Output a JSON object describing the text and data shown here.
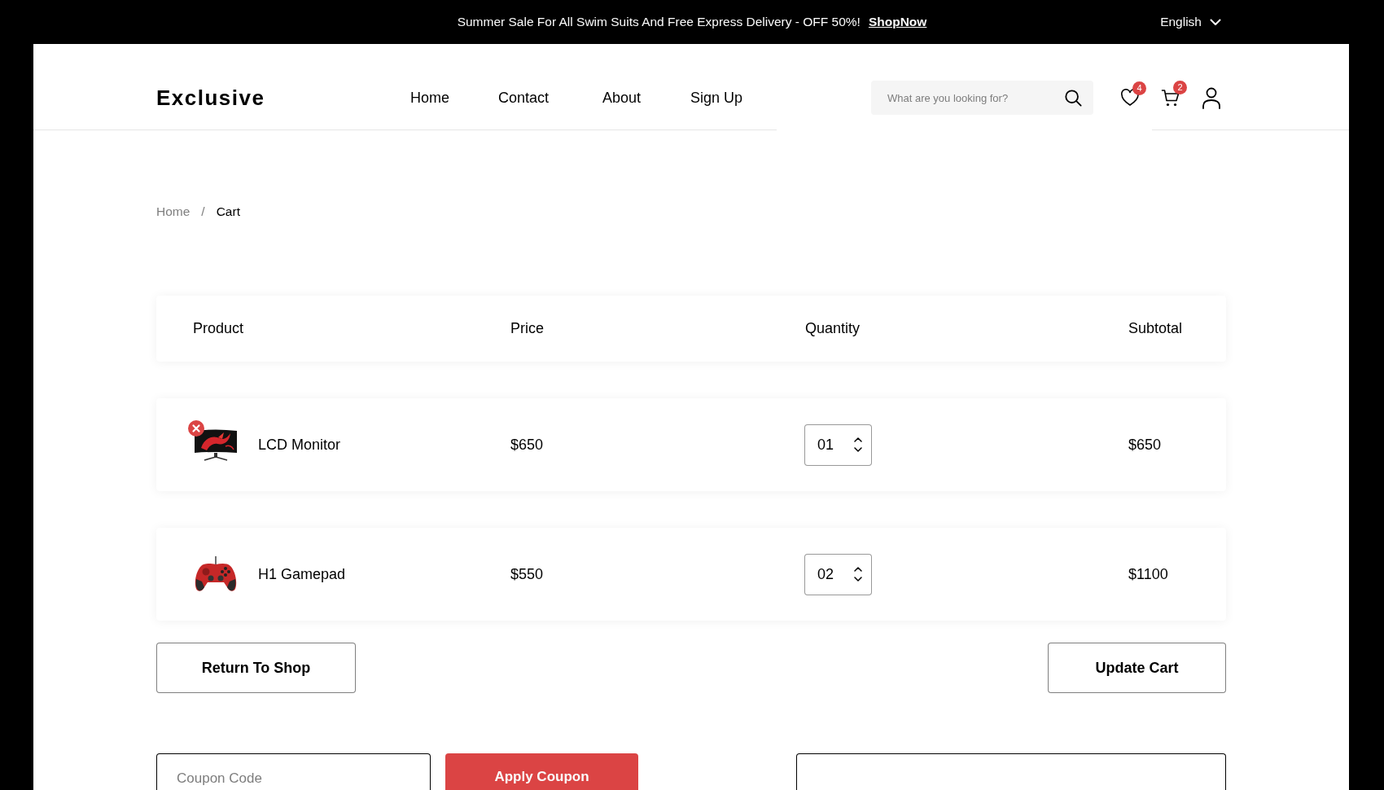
{
  "top_bar": {
    "promo": "Summer Sale For All Swim Suits And Free Express Delivery - OFF 50%!",
    "link": "ShopNow",
    "language": "English"
  },
  "header": {
    "logo": "Exclusive",
    "nav": [
      {
        "label": "Home"
      },
      {
        "label": "Contact"
      },
      {
        "label": "About"
      },
      {
        "label": "Sign Up"
      }
    ],
    "search": {
      "placeholder": "What are you looking for?"
    },
    "wishlist_count": "4",
    "cart_count": "2"
  },
  "breadcrumb": {
    "separator": "/",
    "items": [
      {
        "label": "Home",
        "current": false
      },
      {
        "label": "Cart",
        "current": true
      }
    ]
  },
  "cart_table": {
    "columns": [
      "Product",
      "Price",
      "Quantity",
      "Subtotal"
    ],
    "rows": [
      {
        "product": "LCD Monitor",
        "kind": "monitor",
        "remove_visible": true,
        "price": "$650",
        "quantity": "01",
        "subtotal": "$650"
      },
      {
        "product": "H1 Gamepad",
        "kind": "gamepad",
        "remove_visible": false,
        "price": "$550",
        "quantity": "02",
        "subtotal": "$1100"
      }
    ]
  },
  "actions": [
    "Return To Shop",
    "Update Cart"
  ],
  "coupon": {
    "placeholder": "Coupon Code",
    "button": "Apply Coupon"
  }
}
